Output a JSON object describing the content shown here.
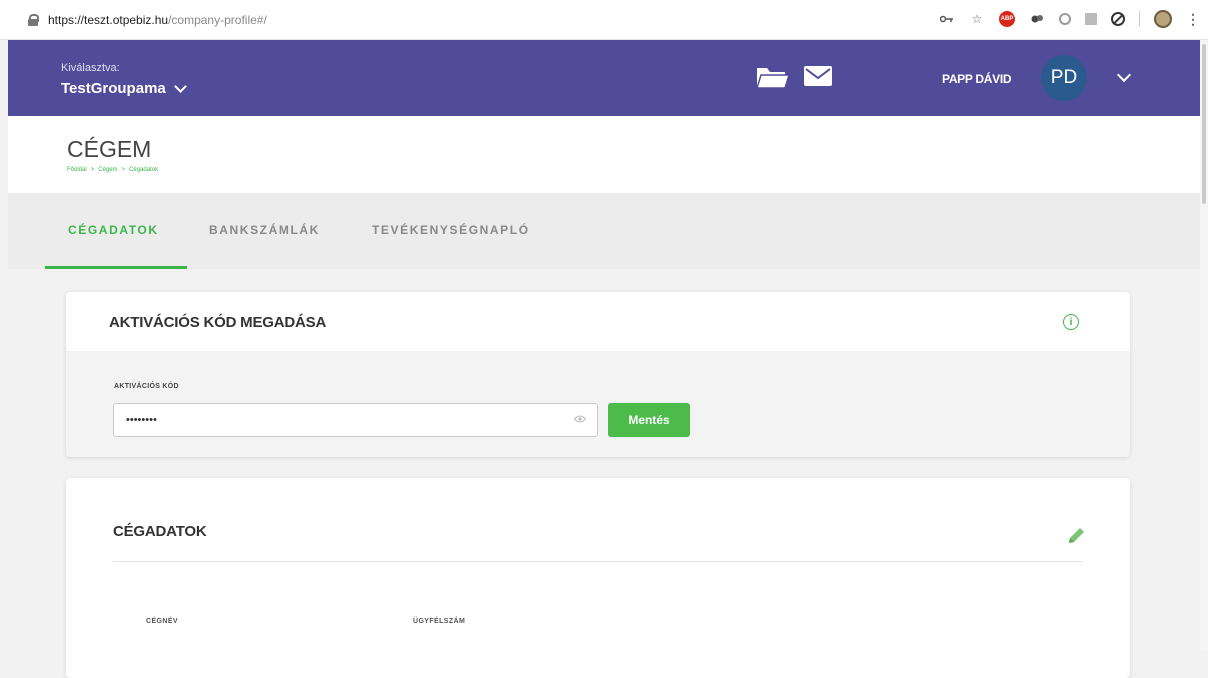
{
  "browser": {
    "url_host": "https://teszt.otpebiz.hu",
    "url_path": "/company-profile#/",
    "adblock_label": "ABP"
  },
  "header": {
    "selected_label": "Kiválasztva:",
    "selected_value": "TestGroupama",
    "user_name": "PAPP DÁVID",
    "avatar_initials": "PD",
    "brand_color": "#514c9a"
  },
  "page": {
    "title": "CÉGEM",
    "breadcrumb": [
      "Főoldal",
      ">",
      "Cégem",
      ">",
      "Cégadatok"
    ]
  },
  "tabs": [
    {
      "label": "CÉGADATOK",
      "active": true
    },
    {
      "label": "BANKSZÁMLÁK",
      "active": false
    },
    {
      "label": "TEVÉKENYSÉGNAPLÓ",
      "active": false
    }
  ],
  "activation": {
    "title": "AKTIVÁCIÓS KÓD MEGADÁSA",
    "info_icon": "i",
    "field_label": "AKTIVÁCIÓS KÓD",
    "field_value": "••••••••",
    "save_label": "Mentés"
  },
  "company": {
    "title": "CÉGADATOK",
    "columns": [
      "CÉGNÉV",
      "ÜGYFÉLSZÁM"
    ]
  },
  "colors": {
    "accent_green": "#3bb54a",
    "avatar_blue": "#2b5a8e"
  }
}
